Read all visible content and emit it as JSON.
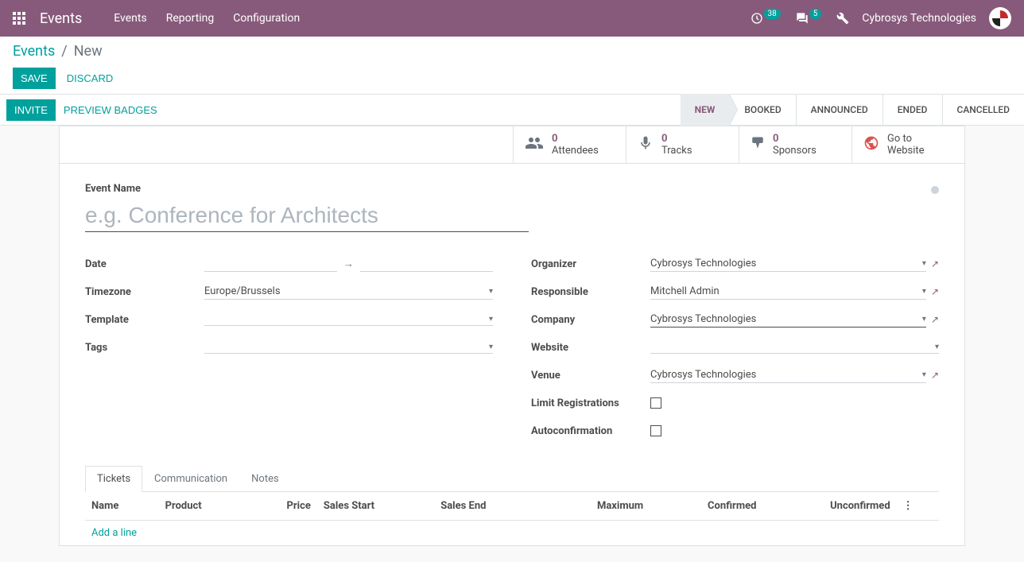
{
  "navbar": {
    "brand": "Events",
    "menu": [
      "Events",
      "Reporting",
      "Configuration"
    ],
    "activity_count": "38",
    "message_count": "5",
    "user": "Cybrosys Technologies"
  },
  "breadcrumb": {
    "root": "Events",
    "current": "New"
  },
  "buttons": {
    "save": "SAVE",
    "discard": "DISCARD",
    "invite": "INVITE",
    "preview": "PREVIEW BADGES"
  },
  "statuses": [
    "NEW",
    "BOOKED",
    "ANNOUNCED",
    "ENDED",
    "CANCELLED"
  ],
  "statbtns": {
    "attendees": {
      "count": "0",
      "label": "Attendees"
    },
    "tracks": {
      "count": "0",
      "label": "Tracks"
    },
    "sponsors": {
      "count": "0",
      "label": "Sponsors"
    },
    "website": {
      "line1": "Go to",
      "line2": "Website"
    }
  },
  "form": {
    "event_name_label": "Event Name",
    "event_name_placeholder": "e.g. Conference for Architects",
    "left": {
      "date": "Date",
      "timezone": "Timezone",
      "timezone_val": "Europe/Brussels",
      "template": "Template",
      "tags": "Tags"
    },
    "right": {
      "organizer": "Organizer",
      "organizer_val": "Cybrosys Technologies",
      "responsible": "Responsible",
      "responsible_val": "Mitchell Admin",
      "company": "Company",
      "company_val": "Cybrosys Technologies",
      "website": "Website",
      "venue": "Venue",
      "venue_val": "Cybrosys Technologies",
      "limit": "Limit Registrations",
      "autoconf": "Autoconfirmation"
    }
  },
  "tabs": [
    "Tickets",
    "Communication",
    "Notes"
  ],
  "tickets_table": {
    "cols": [
      "Name",
      "Product",
      "Price",
      "Sales Start",
      "Sales End",
      "Maximum",
      "Confirmed",
      "Unconfirmed"
    ],
    "addline": "Add a line"
  }
}
